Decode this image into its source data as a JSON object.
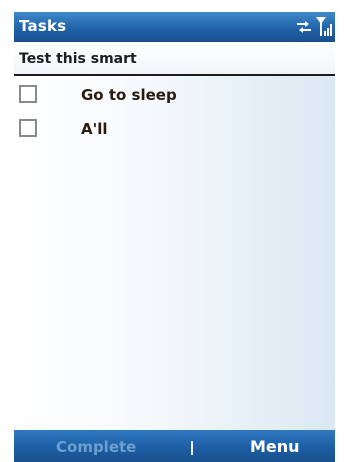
{
  "titlebar": {
    "title": "Tasks",
    "icons": [
      "sync-icon",
      "signal-strength-icon"
    ]
  },
  "entry": {
    "value": "Test this smart"
  },
  "tasks": [
    {
      "label": "Go to sleep",
      "checked": false
    },
    {
      "label": "A'll",
      "checked": false
    }
  ],
  "softkeys": {
    "left": "Complete",
    "left_enabled": false,
    "right": "Menu"
  },
  "colors": {
    "titlebar": "#1f5fa6",
    "softbar": "#1d5ea4",
    "disabled_softkey": "#6d9fd0"
  }
}
